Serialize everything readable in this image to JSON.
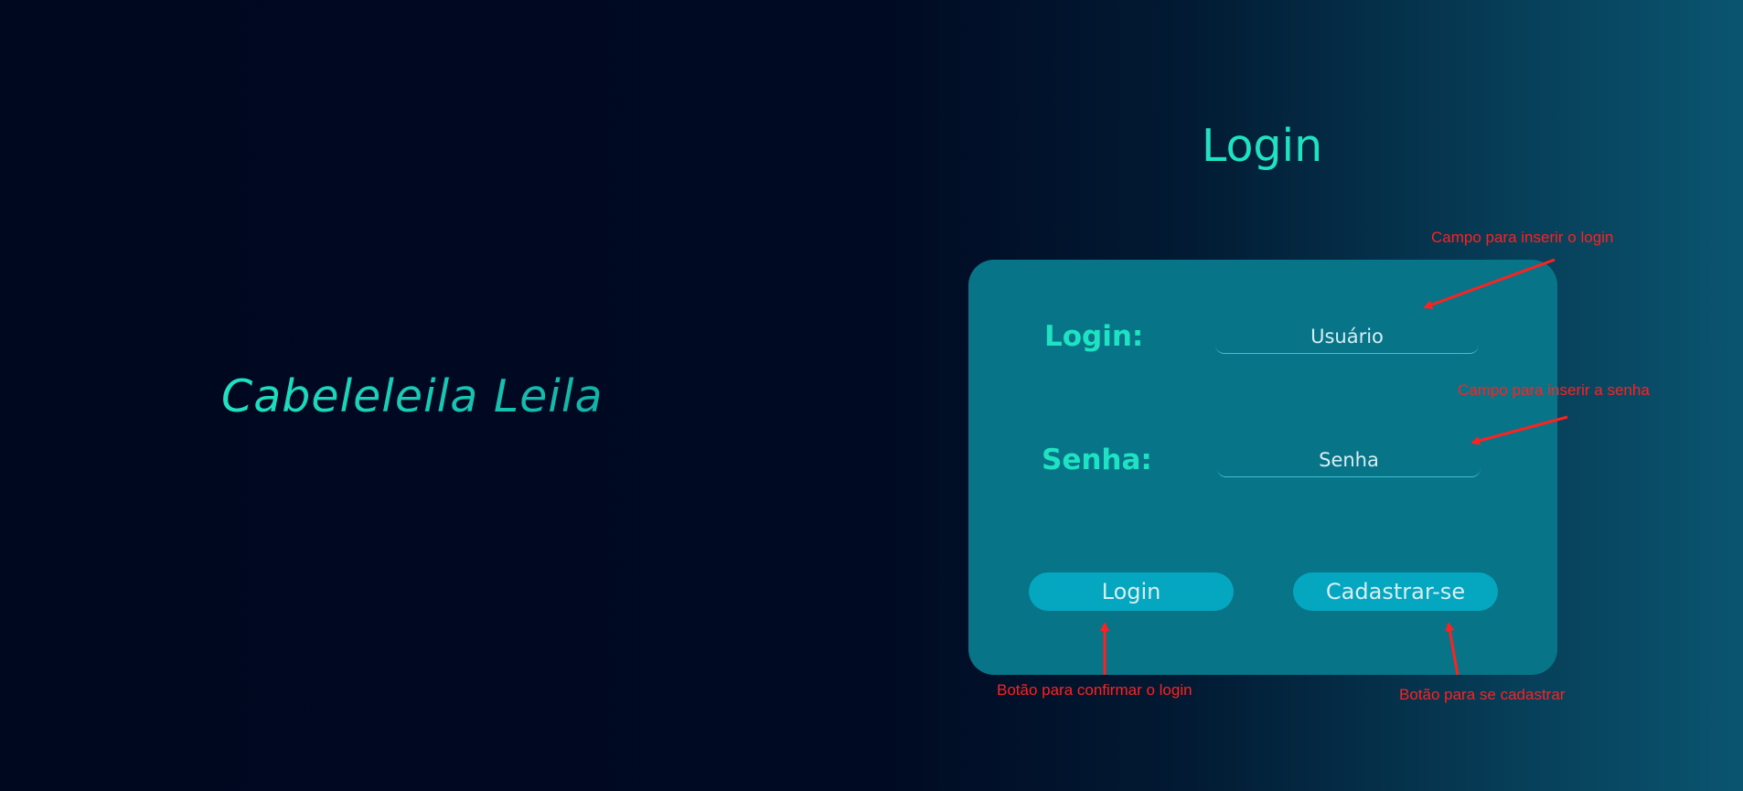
{
  "brand": {
    "name": "Cabeleleila Leila"
  },
  "page": {
    "title": "Login"
  },
  "form": {
    "login_label": "Login:",
    "login_placeholder": "Usuário",
    "password_label": "Senha:",
    "password_placeholder": "Senha",
    "login_button": "Login",
    "register_button": "Cadastrar-se"
  },
  "annotations": {
    "login_field": "Campo para inserir o login",
    "password_field": "Campo para inserir a senha",
    "login_button": "Botão para confirmar o login",
    "register_button": "Botão para se cadastrar"
  },
  "colors": {
    "accent": "#1ee3c2",
    "card": "#087488",
    "button": "#05a6c0",
    "annotation": "#ff2020"
  }
}
